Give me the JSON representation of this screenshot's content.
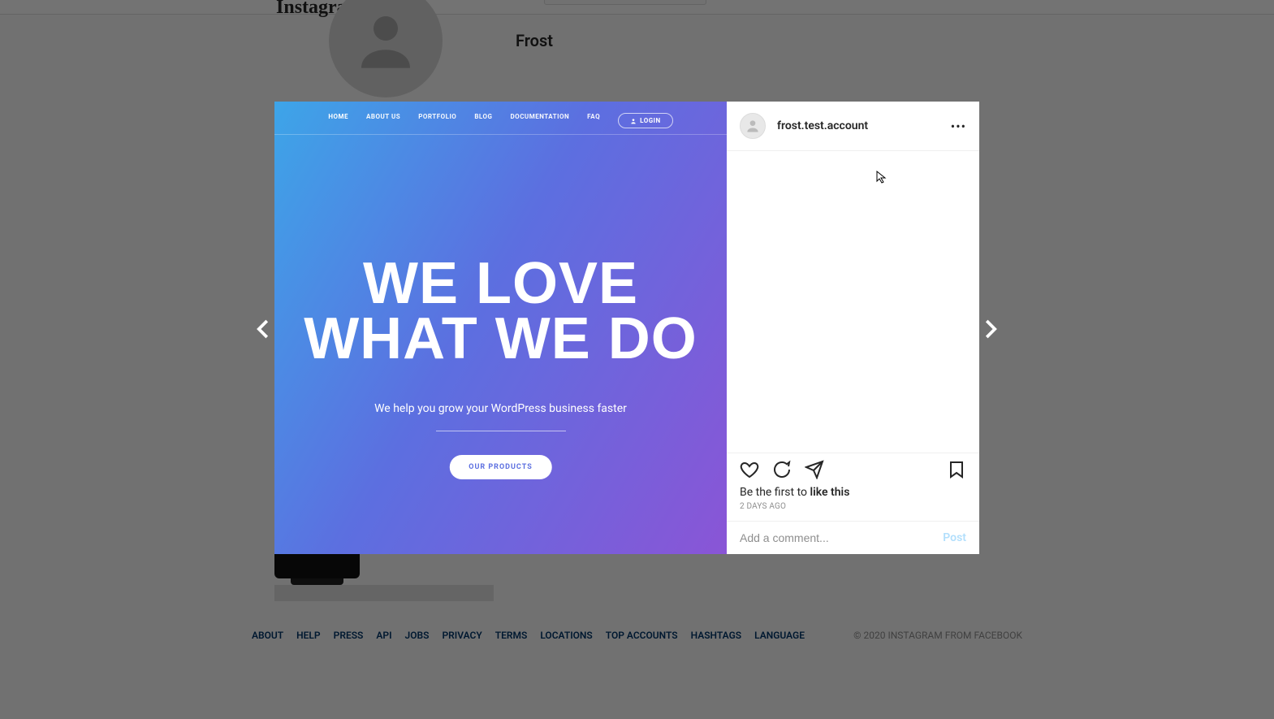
{
  "header": {
    "logo": "Instagram"
  },
  "profile": {
    "display_name": "Frost"
  },
  "post": {
    "username": "frost.test.account",
    "media": {
      "nav": [
        "HOME",
        "ABOUT US",
        "PORTFOLIO",
        "BLOG",
        "DOCUMENTATION",
        "FAQ"
      ],
      "login_label": "LOGIN",
      "headline_line1": "WE LOVE",
      "headline_line2": "WHAT WE DO",
      "subhead": "We help you grow your WordPress business faster",
      "cta": "OUR PRODUCTS"
    },
    "likes_prefix": "Be the first to ",
    "likes_action": "like this",
    "timestamp": "2 DAYS AGO",
    "comment_placeholder": "Add a comment...",
    "post_button": "Post"
  },
  "footer": {
    "links": [
      "ABOUT",
      "HELP",
      "PRESS",
      "API",
      "JOBS",
      "PRIVACY",
      "TERMS",
      "LOCATIONS",
      "TOP ACCOUNTS",
      "HASHTAGS",
      "LANGUAGE"
    ],
    "copyright": "© 2020 INSTAGRAM FROM FACEBOOK"
  }
}
